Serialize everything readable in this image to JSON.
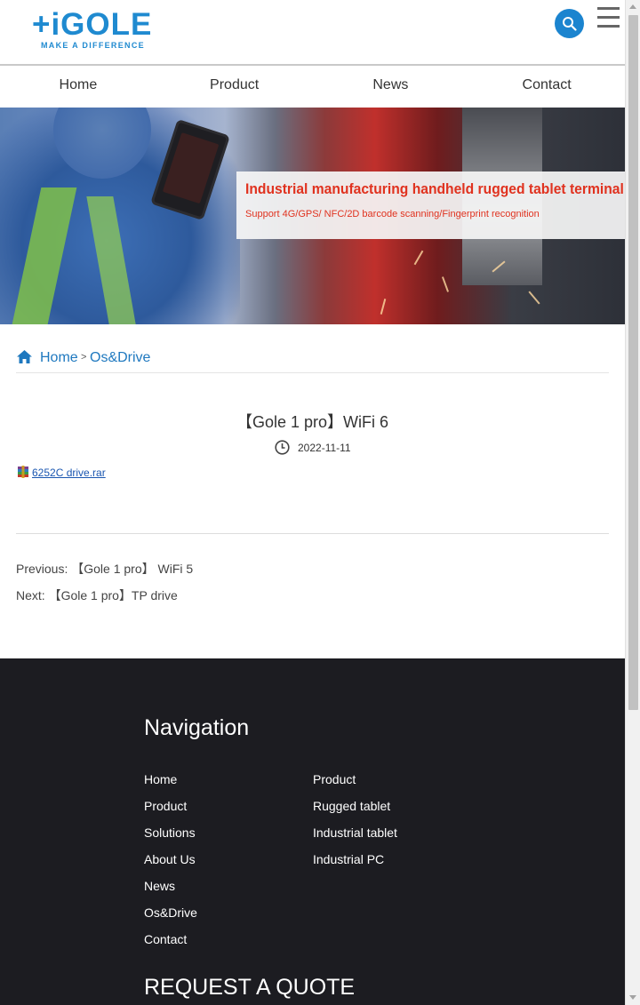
{
  "header": {
    "logo_text": "+iGOLE",
    "logo_tagline": "MAKE A DIFFERENCE",
    "brand_color": "#1f8ad0",
    "search_icon": "search-icon",
    "menu_icon": "hamburger-menu-icon"
  },
  "nav": {
    "items": [
      {
        "label": "Home"
      },
      {
        "label": "Product"
      },
      {
        "label": "News"
      },
      {
        "label": "Contact"
      }
    ]
  },
  "banner": {
    "title": "Industrial manufacturing handheld rugged tablet terminal",
    "subtitle": "Support 4G/GPS/ NFC/2D barcode scanning/Fingerprint recognition"
  },
  "breadcrumb": {
    "home_icon": "home-icon",
    "home": "Home",
    "separator": ">",
    "current": "Os&Drive"
  },
  "article": {
    "title": "【Gole 1 pro】WiFi 6",
    "date_icon": "clock-icon",
    "date": "2022-11-11",
    "attachment_icon": "rar-file-icon",
    "attachment": "6252C drive.rar"
  },
  "pager": {
    "previous": "Previous: 【Gole 1 pro】 WiFi 5",
    "next": "Next: 【Gole 1 pro】TP drive"
  },
  "footer": {
    "heading": "Navigation",
    "col1": [
      "Home",
      "Product",
      "Solutions",
      "About Us",
      "News",
      "Os&Drive",
      "Contact"
    ],
    "col2": [
      "Product",
      "Rugged tablet",
      "Industrial tablet",
      "Industrial PC"
    ],
    "quote": "REQUEST A QUOTE"
  }
}
